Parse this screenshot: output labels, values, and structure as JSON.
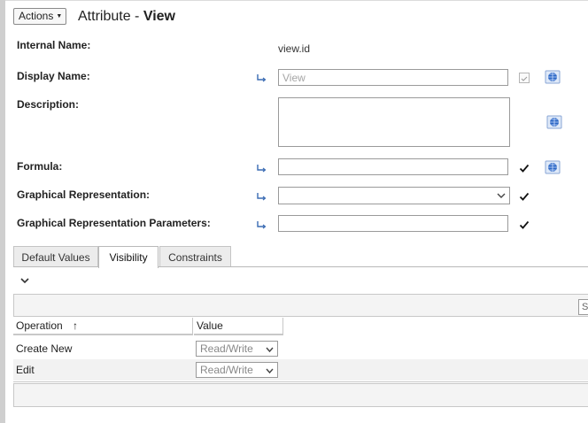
{
  "header": {
    "actions_label": "Actions",
    "title_prefix": "Attribute - ",
    "title_name": "View"
  },
  "form": {
    "internal_name": {
      "label": "Internal Name:",
      "value": "view.id"
    },
    "display_name": {
      "label": "Display Name:",
      "placeholder": "View"
    },
    "description": {
      "label": "Description:",
      "value": ""
    },
    "formula": {
      "label": "Formula:",
      "value": ""
    },
    "graphical_representation": {
      "label": "Graphical Representation:",
      "value": ""
    },
    "graphical_representation_parameters": {
      "label": "Graphical Representation Parameters:",
      "value": ""
    }
  },
  "tabs": [
    {
      "label": "Default Values",
      "active": false
    },
    {
      "label": "Visibility",
      "active": true
    },
    {
      "label": "Constraints",
      "active": false
    }
  ],
  "table": {
    "search_placeholder": "Se",
    "columns": {
      "operation": "Operation",
      "value": "Value"
    },
    "sort_indicator": "↑",
    "rows": [
      {
        "operation": "Create New",
        "value": "Read/Write"
      },
      {
        "operation": "Edit",
        "value": "Read/Write"
      }
    ]
  },
  "icons": {
    "link": "link-arrow-icon",
    "check": "checkmark-icon",
    "globe": "localize-globe-icon",
    "collapse": "chevron-down-icon"
  },
  "colors": {
    "globe_blue": "#2b66c4",
    "border": "#9a9a9a",
    "tab_bg": "#ececec"
  }
}
